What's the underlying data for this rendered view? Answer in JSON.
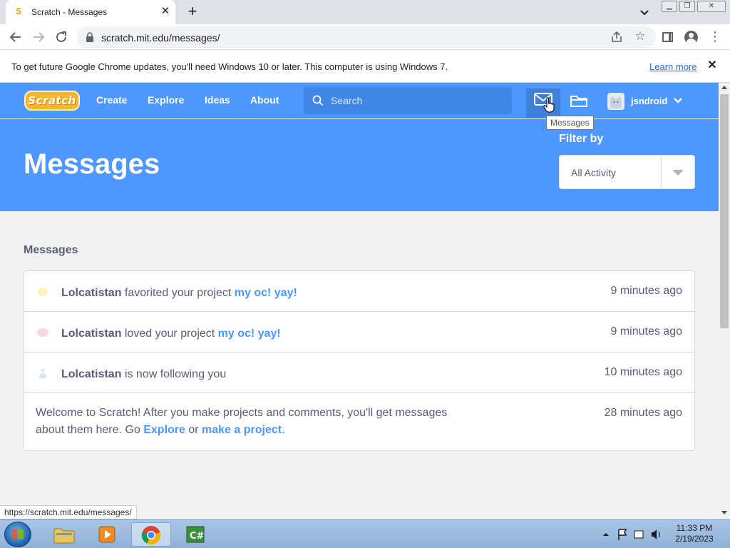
{
  "browser": {
    "tab_title": "Scratch - Messages",
    "url": "scratch.mit.edu/messages/",
    "infobar_message": "To get future Google Chrome updates, you'll need Windows 10 or later. This computer is using Windows 7.",
    "infobar_link": "Learn more",
    "status_url": "https://scratch.mit.edu/messages/"
  },
  "nav": {
    "logo": "Scratch",
    "links": [
      "Create",
      "Explore",
      "Ideas",
      "About"
    ],
    "search_placeholder": "Search",
    "username": "jsndroid",
    "tooltip": "Messages",
    "accent": "#4d97ff"
  },
  "hero": {
    "title": "Messages",
    "filter_label": "Filter by",
    "filter_value": "All Activity"
  },
  "messages": {
    "section_title": "Messages",
    "items": [
      {
        "icon": "star-icon",
        "user": "Lolcatistan",
        "action": "favorited your project",
        "project": "my oc! yay!",
        "time": "9 minutes ago"
      },
      {
        "icon": "heart-icon",
        "user": "Lolcatistan",
        "action": "loved your project",
        "project": "my oc! yay!",
        "time": "9 minutes ago"
      },
      {
        "icon": "follow-icon",
        "user": "Lolcatistan",
        "action": "is now following you",
        "time": "10 minutes ago"
      }
    ],
    "welcome": {
      "text_before": "Welcome to Scratch! After you make projects and comments, you'll get messages about them here. Go",
      "link1": "Explore",
      "or": "or",
      "link2": "make a project",
      "end": ".",
      "time": "28 minutes ago"
    }
  },
  "taskbar": {
    "time": "11:33 PM",
    "date": "2/19/2023"
  }
}
